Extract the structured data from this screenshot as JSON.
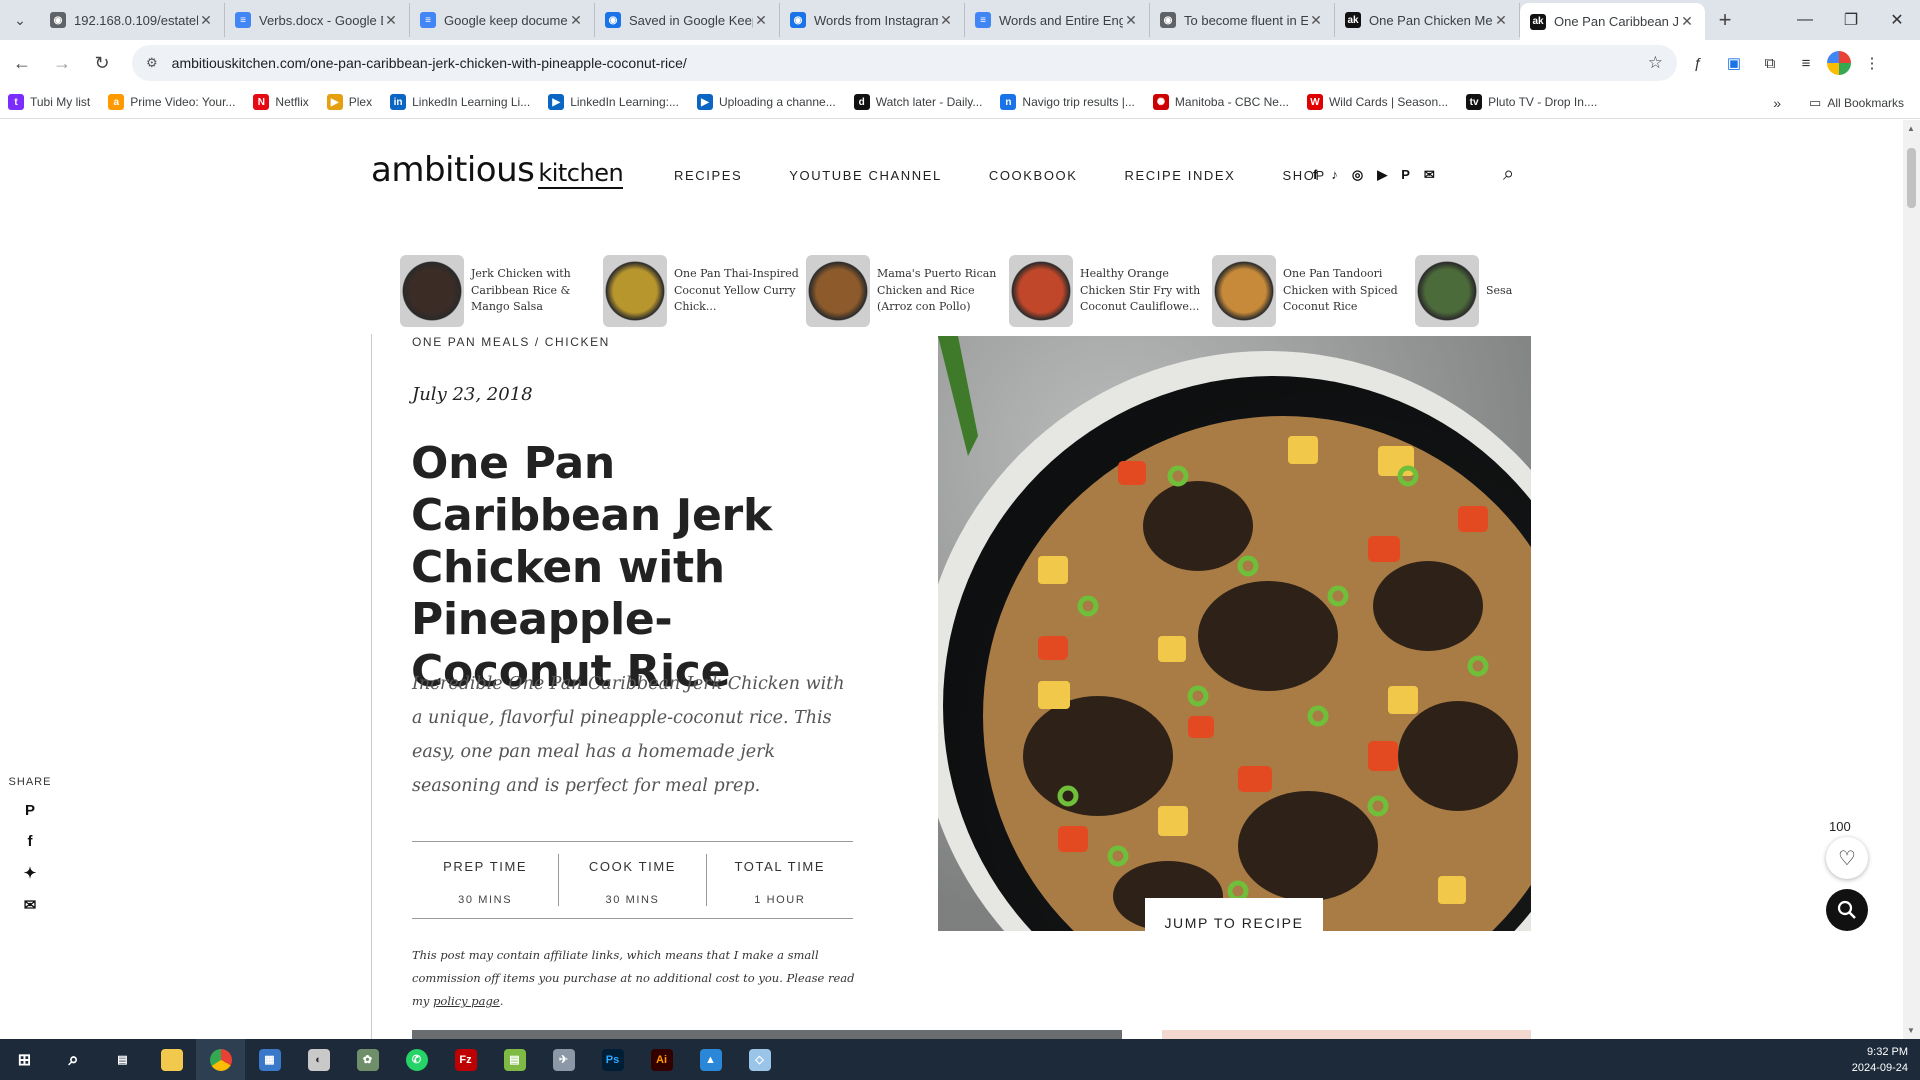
{
  "browser": {
    "tabs": [
      {
        "title": "192.168.0.109/estatel",
        "icon": "globe-icon",
        "color": "#5f6368"
      },
      {
        "title": "Verbs.docx - Google D",
        "icon": "docs-icon",
        "color": "#4285f4"
      },
      {
        "title": "Google keep docume",
        "icon": "docs-icon",
        "color": "#4285f4"
      },
      {
        "title": "Saved in Google Keep",
        "icon": "globe-icon",
        "color": "#1a73e8"
      },
      {
        "title": "Words from Instagram",
        "icon": "globe-icon",
        "color": "#1a73e8"
      },
      {
        "title": "Words and Entire Eng",
        "icon": "docs-icon",
        "color": "#4285f4"
      },
      {
        "title": "To become fluent in E",
        "icon": "globe-icon",
        "color": "#5f6368"
      },
      {
        "title": "One Pan Chicken Me",
        "icon": "ak-icon",
        "color": "#111111"
      },
      {
        "title": "One Pan Caribbean Je",
        "icon": "ak-icon",
        "color": "#111111",
        "active": true
      }
    ],
    "url": "ambitiouskitchen.com/one-pan-caribbean-jerk-chicken-with-pineapple-coconut-rice/",
    "bookmarks": [
      {
        "label": "Tubi My list",
        "color": "#7b2cff",
        "glyph": "t"
      },
      {
        "label": "Prime Video: Your...",
        "color": "#ff9900",
        "glyph": "a"
      },
      {
        "label": "Netflix",
        "color": "#e50914",
        "glyph": "N"
      },
      {
        "label": "Plex",
        "color": "#e5a00d",
        "glyph": "▶"
      },
      {
        "label": "LinkedIn Learning Li...",
        "color": "#0a66c2",
        "glyph": "in"
      },
      {
        "label": "LinkedIn Learning:...",
        "color": "#0a66c2",
        "glyph": "▶"
      },
      {
        "label": "Uploading a channe...",
        "color": "#0a66c2",
        "glyph": "▶"
      },
      {
        "label": "Watch later - Daily...",
        "color": "#111111",
        "glyph": "d"
      },
      {
        "label": "Navigo trip results |...",
        "color": "#1a73e8",
        "glyph": "n"
      },
      {
        "label": "Manitoba - CBC Ne...",
        "color": "#cc0000",
        "glyph": "✺"
      },
      {
        "label": "Wild Cards | Season...",
        "color": "#e00000",
        "glyph": "W"
      },
      {
        "label": "Pluto TV - Drop In....",
        "color": "#111111",
        "glyph": "tv"
      }
    ],
    "all_bookmarks": "All Bookmarks"
  },
  "site": {
    "logo_main": "ambitious",
    "logo_sub": "kitchen",
    "nav": [
      "RECIPES",
      "YOUTUBE CHANNEL",
      "COOKBOOK",
      "RECIPE INDEX",
      "SHOP"
    ],
    "social": [
      "f",
      "♪",
      "◎",
      "▶",
      "P",
      "✉"
    ]
  },
  "carousel": [
    {
      "title": "Jerk Chicken with Caribbean Rice & Mango Salsa",
      "tone": "#3b2c26"
    },
    {
      "title": "One Pan Thai-Inspired Coconut Yellow Curry Chick...",
      "tone": "#b8962e"
    },
    {
      "title": "Mama's Puerto Rican Chicken and Rice (Arroz con Pollo)",
      "tone": "#8c5a2b"
    },
    {
      "title": "Healthy Orange Chicken Stir Fry with Coconut Cauliflowe...",
      "tone": "#c0472a"
    },
    {
      "title": "One Pan Tandoori Chicken with Spiced Coconut Rice",
      "tone": "#c78a3a"
    },
    {
      "title": "Sesame Fry w Ging...",
      "tone": "#4c6b3a"
    }
  ],
  "post": {
    "categories": "ONE PAN MEALS /  CHICKEN",
    "date": "July 23, 2018",
    "title": "One Pan Caribbean Jerk Chicken with Pineapple-Coconut Rice",
    "description": "Incredible One Pan Caribbean Jerk Chicken with a unique, flavorful pineapple-coconut rice. This easy, one pan meal has a homemade jerk seasoning and is perfect for meal prep.",
    "times": [
      {
        "label": "PREP TIME",
        "value": "30 MINS"
      },
      {
        "label": "COOK TIME",
        "value": "30 MINS"
      },
      {
        "label": "TOTAL TIME",
        "value": "1 HOUR"
      }
    ],
    "disclaimer": "This post may contain affiliate links, which means that I make a small commission off items you purchase at no additional cost to you. Please read my ",
    "disclaimer_link": "policy page",
    "disclaimer_end": ".",
    "jump_button": "JUMP TO RECIPE"
  },
  "share": {
    "label": "SHARE"
  },
  "favorites": {
    "count": "100"
  },
  "taskbar": {
    "time": "9:32 PM",
    "date": "2024-09-24"
  }
}
